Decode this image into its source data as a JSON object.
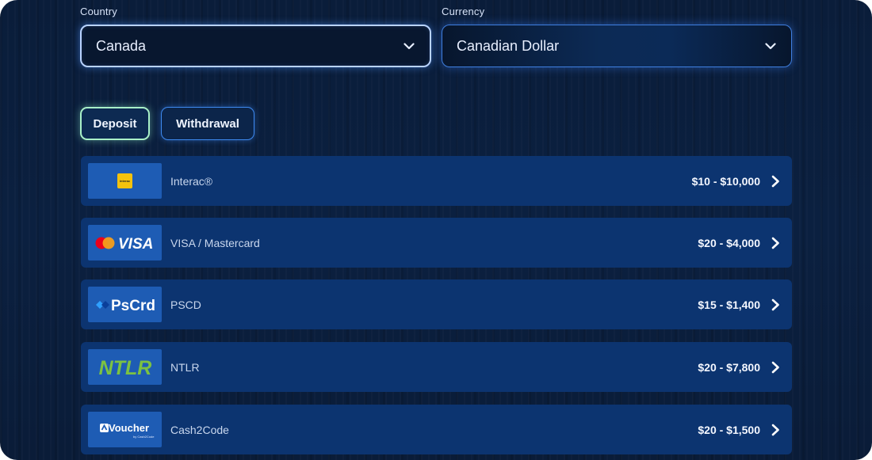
{
  "country": {
    "label": "Country",
    "value": "Canada"
  },
  "currency": {
    "label": "Currency",
    "value": "Canadian Dollar"
  },
  "tabs": {
    "deposit": "Deposit",
    "withdrawal": "Withdrawal"
  },
  "methods": [
    {
      "name": "Interac®",
      "range": "$10 - $10,000",
      "logo_text": "interac",
      "icon": "interac-logo"
    },
    {
      "name": "VISA / Mastercard",
      "range": "$20 - $4,000",
      "logo_text": "VISA",
      "icon": "visa-mastercard-logo"
    },
    {
      "name": "PSCD",
      "range": "$15 - $1,400",
      "logo_text": "PsCrd",
      "icon": "paysafecard-logo"
    },
    {
      "name": "NTLR",
      "range": "$20 - $7,800",
      "logo_text": "NTLR",
      "icon": "neteller-logo"
    },
    {
      "name": "Cash2Code",
      "range": "$20 - $1,500",
      "logo_text": "Voucher",
      "icon": "avoucher-logo"
    }
  ],
  "colors": {
    "background": "#0a1d3a",
    "row": "#0c3470",
    "logo_bg": "#1e5cb4",
    "deposit_border": "#a9f0c8",
    "ntlr_green": "#7cc242"
  }
}
